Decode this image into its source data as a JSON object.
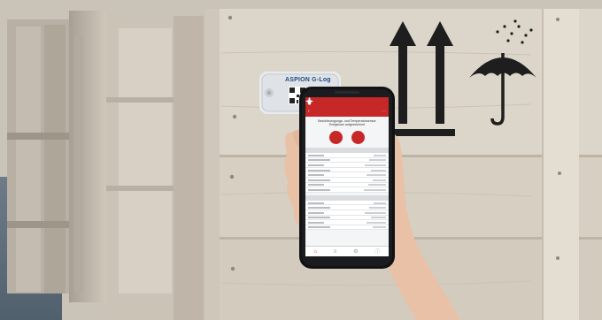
{
  "logger": {
    "brand": "ASPION G-Log"
  },
  "phone": {
    "screen": {
      "nav_back": "‹",
      "nav_more": "⋯",
      "headline": "Beschleunigungs- und Temperatursensor Ereignisse aufgezeichnet",
      "alert_icons": [
        "shock-alert-icon",
        "thermometer-alert-icon"
      ],
      "sections": [
        {
          "rows": 8
        },
        {
          "rows": 6
        }
      ],
      "tab_icons": [
        "home-icon",
        "list-icon",
        "settings-icon",
        "info-icon"
      ]
    }
  },
  "colors": {
    "accent_red": "#c62828",
    "logger_blue": "#1e4c86",
    "crate_wood": "#d9d2c6",
    "print_black": "#1a1a1a"
  }
}
